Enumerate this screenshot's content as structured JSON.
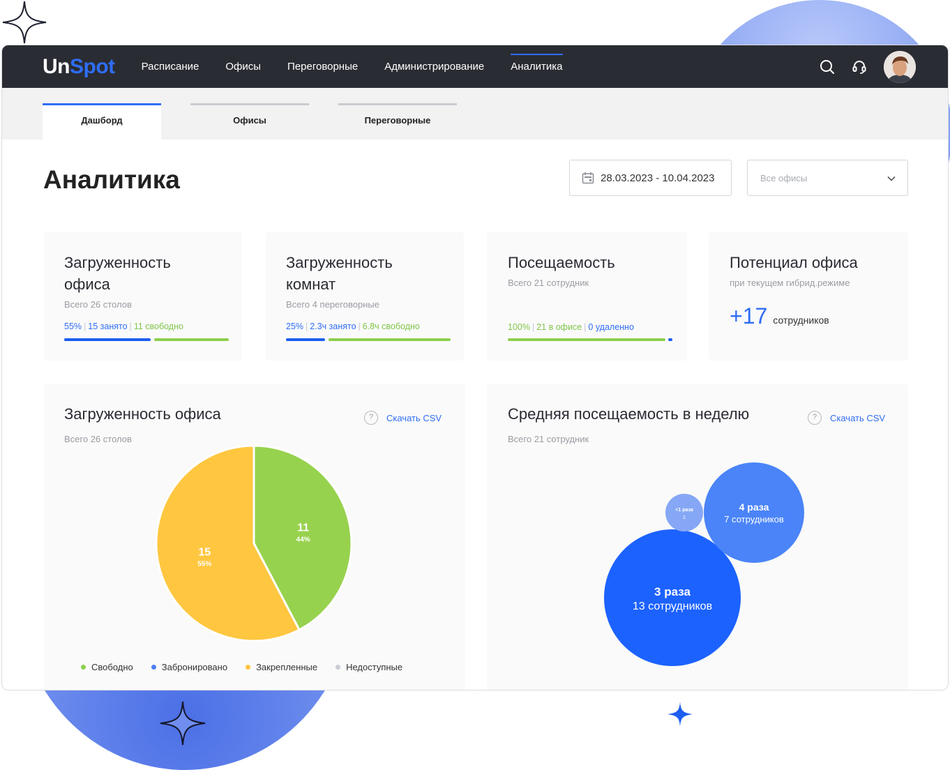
{
  "brand": {
    "logo_part1": "Un",
    "logo_part2": "Spot"
  },
  "nav": {
    "items": [
      "Расписание",
      "Офисы",
      "Переговорные",
      "Администрирование",
      "Аналитика"
    ],
    "active": "Аналитика"
  },
  "subtabs": [
    "Дашборд",
    "Офисы",
    "Переговорные"
  ],
  "active_subtab": "Дашборд",
  "page": {
    "title": "Аналитика",
    "date_range": "28.03.2023 - 10.04.2023",
    "office_placeholder": "Все офисы"
  },
  "cards": [
    {
      "title_line1": "Загруженность",
      "title_line2": "офиса",
      "subtitle": "Всего 26 столов",
      "stat_percent": "55%",
      "stat_busy": "15 занято",
      "stat_free": "11 свободно",
      "busy_fraction": 0.55
    },
    {
      "title_line1": "Загруженность",
      "title_line2": "комнат",
      "subtitle": "Всего 4 переговорные",
      "stat_percent": "25%",
      "stat_busy": "2.3ч занято",
      "stat_free": "6.8ч свободно",
      "busy_fraction": 0.25
    },
    {
      "title": "Посещаемость",
      "subtitle": "Всего 21 сотрудник",
      "stat_percent": "100%",
      "stat_office": "21 в офисе",
      "stat_remote": "0 удаленно",
      "office_fraction": 1.0
    },
    {
      "title": "Потенциал офиса",
      "subtitle": "при текущем гибрид.режиме",
      "value": "+17",
      "value_label": "сотрудников"
    }
  ],
  "pie_panel": {
    "title": "Загруженность офиса",
    "subtitle": "Всего 26 столов",
    "csv_label": "Скачать CSV",
    "help_label": "?",
    "legend": [
      {
        "label": "Свободно",
        "color": "#8dcf4e"
      },
      {
        "label": "Забронировано",
        "color": "#4d7ef3"
      },
      {
        "label": "Закрепленные",
        "color": "#ffc43d"
      },
      {
        "label": "Недоступные",
        "color": "#c9ccd6"
      }
    ]
  },
  "bubble_panel": {
    "title": "Средняя посещаемость в неделю",
    "subtitle": "Всего 21 сотрудник",
    "csv_label": "Скачать CSV",
    "help_label": "?"
  },
  "chart_data": [
    {
      "type": "pie",
      "title": "Загруженность офиса",
      "slices": [
        {
          "name": "Свободно",
          "value": 11,
          "label": "11",
          "percent_label": "44%",
          "color": "#97d24e"
        },
        {
          "name": "Закрепленные",
          "value": 15,
          "label": "15",
          "percent_label": "55%",
          "color": "#ffc640"
        }
      ]
    },
    {
      "type": "bubble",
      "title": "Средняя посещаемость в неделю",
      "bubbles": [
        {
          "label": "3 раза",
          "sublabel": "13 сотрудников",
          "value": 13,
          "color": "#1c62ff"
        },
        {
          "label": "4 раза",
          "sublabel": "7 сотрудников",
          "value": 7,
          "color": "#4a84f8"
        },
        {
          "label": "<1 раза",
          "sublabel": "1",
          "value": 1,
          "color": "#86a7f5"
        }
      ]
    }
  ]
}
